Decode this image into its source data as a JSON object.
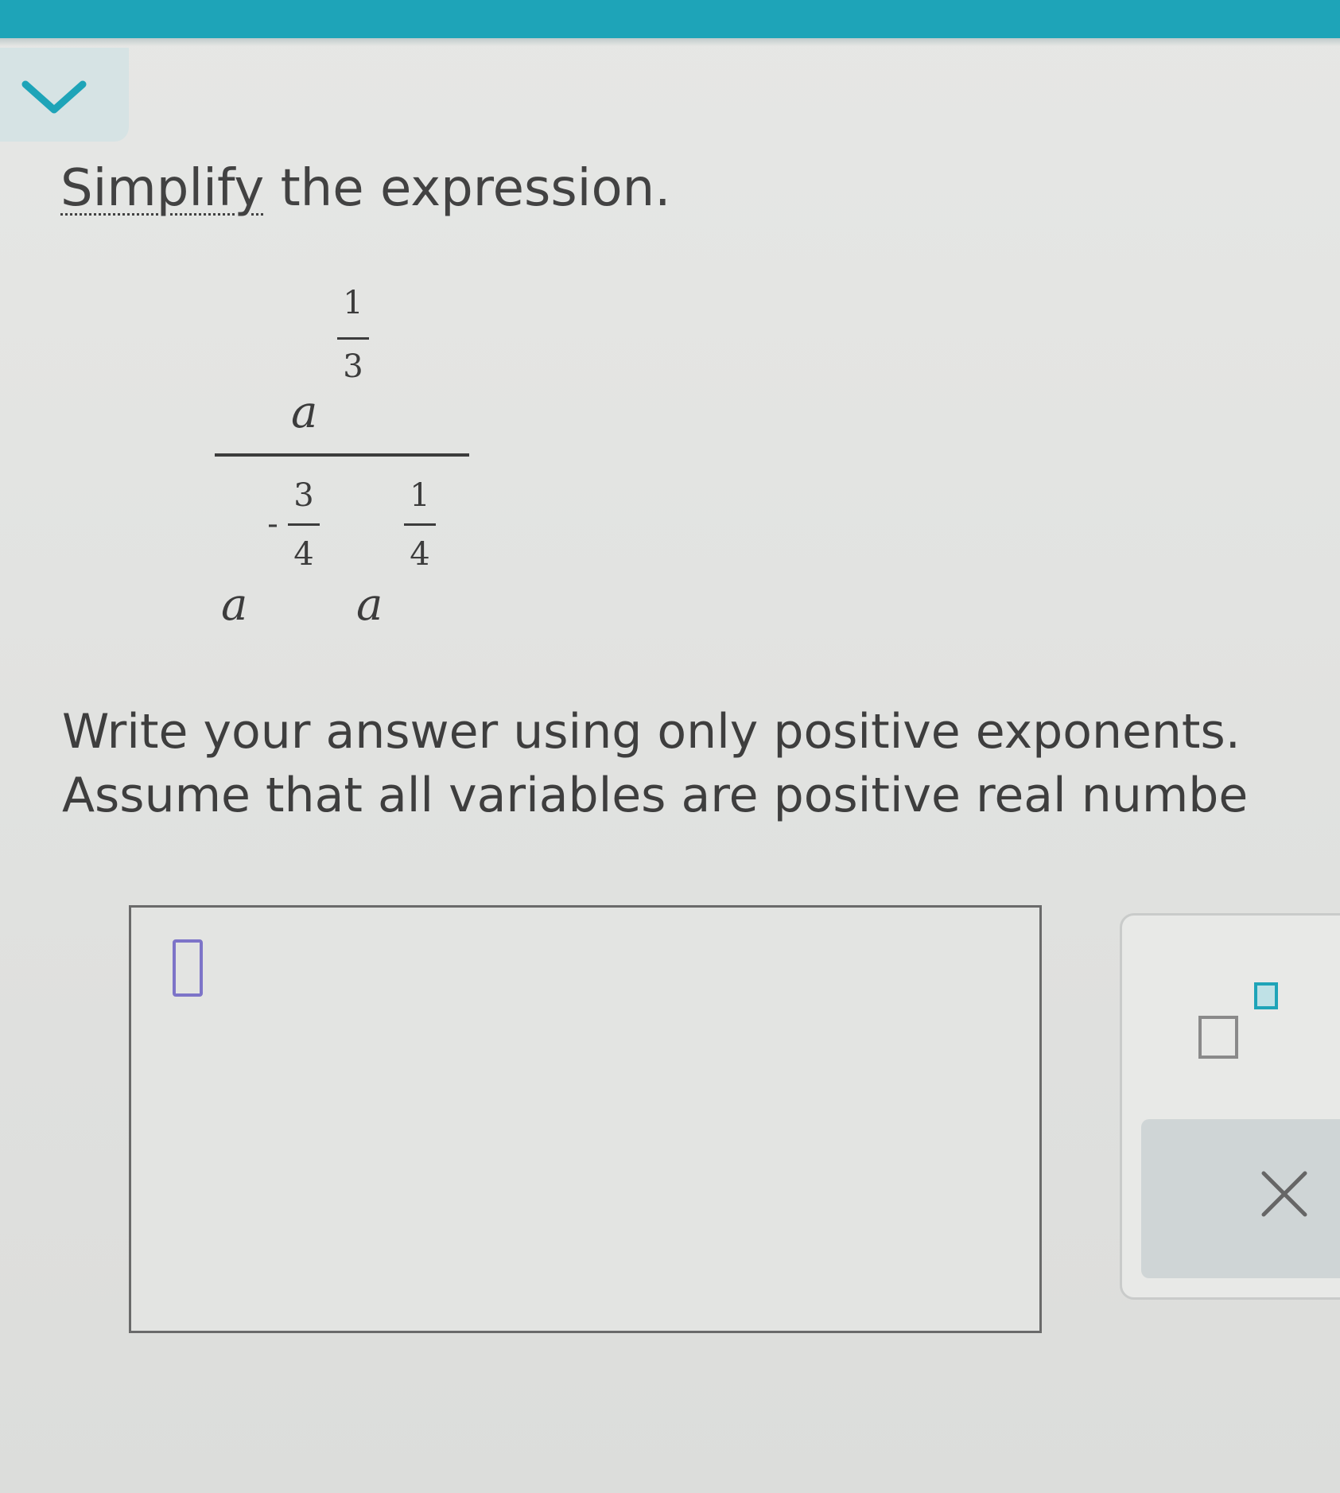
{
  "header": {
    "accent_color": "#1ea4b8",
    "collapse_icon": "chevron-down-icon"
  },
  "question": {
    "prompt_keyword": "Simplify",
    "prompt_rest": " the expression.",
    "expression": {
      "base": "a",
      "numerator": {
        "exponent_numerator": "1",
        "exponent_denominator": "3"
      },
      "denominator_terms": [
        {
          "sign": "-",
          "exponent_numerator": "3",
          "exponent_denominator": "4"
        },
        {
          "sign": "",
          "exponent_numerator": "1",
          "exponent_denominator": "4"
        }
      ]
    },
    "instruction_line1": "Write your answer using only positive exponents.",
    "instruction_line2": "Assume that all variables are positive real numbe"
  },
  "answer": {
    "value": "",
    "cursor_color": "#7d74c8"
  },
  "toolbar": {
    "exponent_button_icon": "superscript-template-icon",
    "clear_button_icon": "close-icon"
  }
}
